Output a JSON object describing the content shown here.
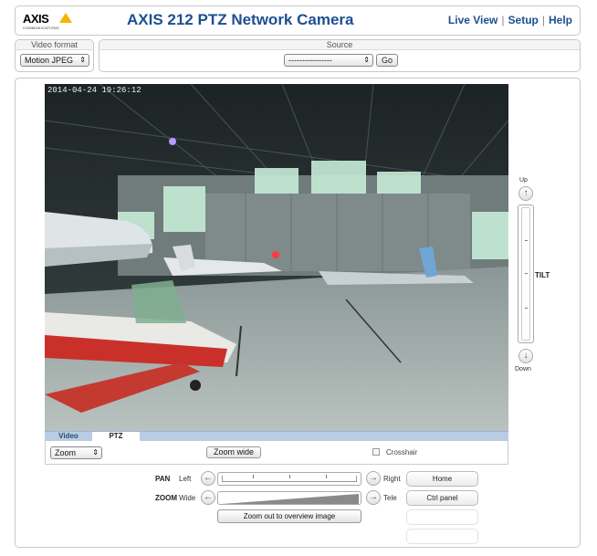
{
  "header": {
    "logo_text": "AXIS",
    "logo_subtext": "COMMUNICATIONS",
    "title": "AXIS 212 PTZ Network Camera",
    "nav": [
      {
        "label": "Live View"
      },
      {
        "label": "Setup"
      },
      {
        "label": "Help"
      }
    ],
    "accent_color": "#1d4f91",
    "logo_color": "#f5b400"
  },
  "video_format": {
    "label": "Video format",
    "selected": "Motion JPEG"
  },
  "source": {
    "label": "Source",
    "selected": "----------------",
    "go_label": "Go"
  },
  "video": {
    "timestamp": "2014-04-24 19:26:12"
  },
  "tabs": [
    {
      "label": "Video",
      "active": false
    },
    {
      "label": "PTZ",
      "active": true
    }
  ],
  "ptz_bar": {
    "mode_selected": "Zoom",
    "zoom_wide_label": "Zoom wide",
    "crosshair_label": "Crosshair",
    "crosshair_checked": false
  },
  "tilt": {
    "label": "TILT",
    "up_label": "Up",
    "down_label": "Down"
  },
  "pan": {
    "label": "PAN",
    "left_label": "Left",
    "right_label": "Right"
  },
  "zoom": {
    "label": "ZOOM",
    "wide_label": "Wide",
    "tele_label": "Tele",
    "overview_label": "Zoom out to overview image"
  },
  "side_buttons": {
    "home_label": "Home",
    "ctrl_panel_label": "Ctrl panel"
  },
  "icons": {
    "left_arrow": "arrow-left-icon",
    "right_arrow": "arrow-right-icon",
    "up_arrow": "arrow-up-icon",
    "down_arrow": "arrow-down-icon"
  }
}
